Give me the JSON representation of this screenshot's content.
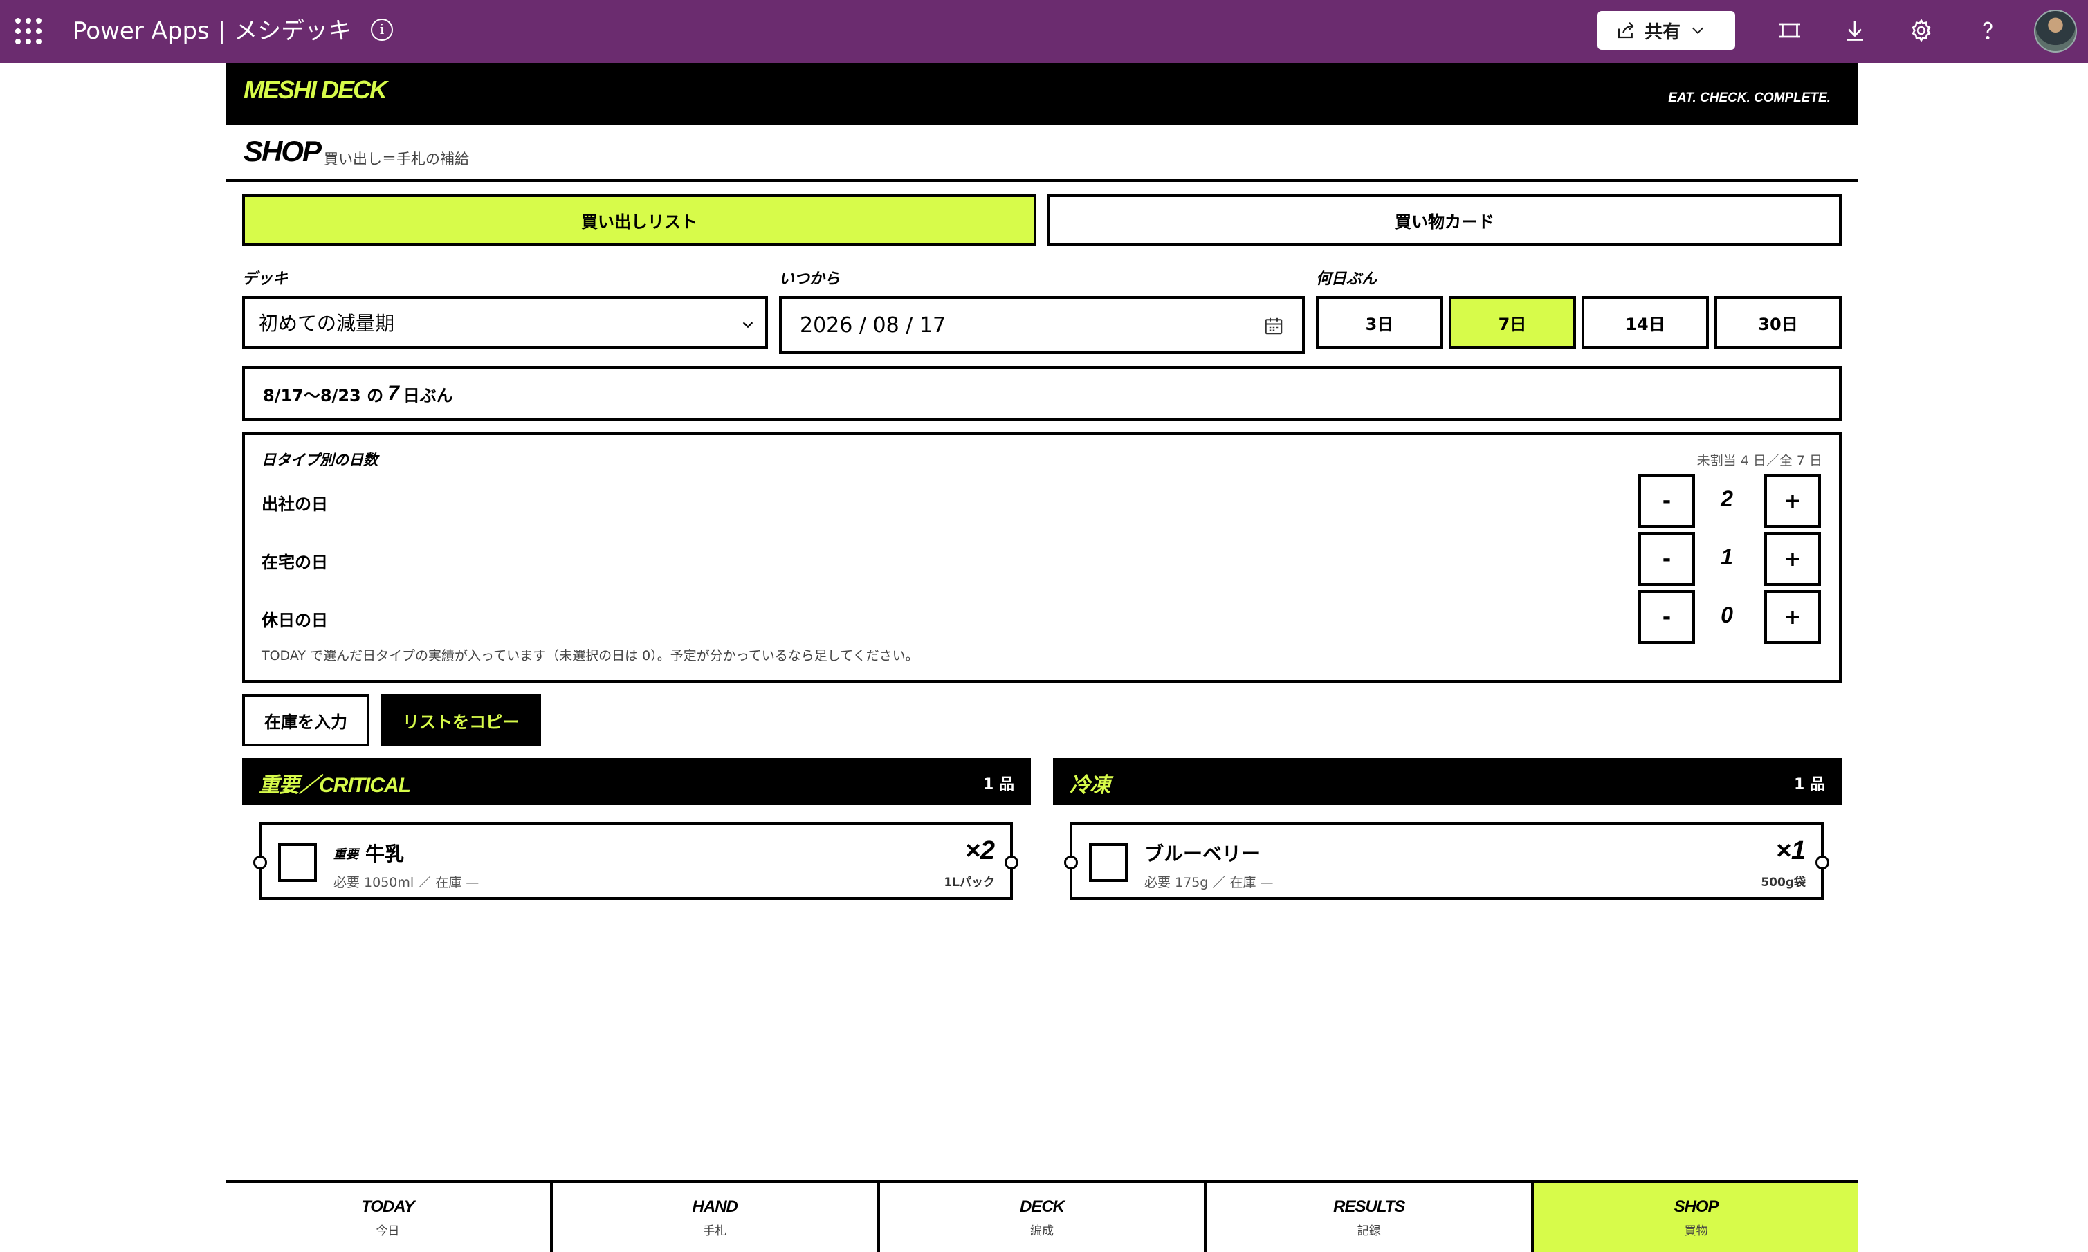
{
  "topbar": {
    "app_name": "Power Apps",
    "separator": "|",
    "app_title": "メシデッキ",
    "share_label": "共有"
  },
  "header": {
    "brand": "MESHI DECK",
    "tagline": "EAT. CHECK. COMPLETE."
  },
  "page": {
    "title": "SHOP",
    "subtitle": "買い出し＝手札の補給"
  },
  "tabs": [
    {
      "label": "買い出しリスト",
      "active": true
    },
    {
      "label": "買い物カード",
      "active": false
    }
  ],
  "filters": {
    "deck_label": "デッキ",
    "deck_value": "初めての減量期",
    "from_label": "いつから",
    "from_value": "2026 / 08 / 17",
    "days_label": "何日ぶん",
    "day_options": [
      {
        "label": "3日",
        "active": false
      },
      {
        "label": "7日",
        "active": true
      },
      {
        "label": "14日",
        "active": false
      },
      {
        "label": "30日",
        "active": false
      }
    ]
  },
  "range": {
    "prefix": "8/17〜8/23 の",
    "days": "7",
    "suffix": "日ぶん"
  },
  "day_types": {
    "title": "日タイプ別の日数",
    "unassigned": "未割当 4 日／全 7 日",
    "rows": [
      {
        "label": "出社の日",
        "value": "2"
      },
      {
        "label": "在宅の日",
        "value": "1"
      },
      {
        "label": "休日の日",
        "value": "0"
      }
    ],
    "minus": "-",
    "plus": "+",
    "note": "TODAY で選んだ日タイプの実績が入っています（未選択の日は 0）。予定が分かっているなら足してください。"
  },
  "actions": {
    "stock_label": "在庫を入力",
    "copy_label": "リストをコピー"
  },
  "categories": [
    {
      "name": "重要／CRITICAL",
      "count": "1 品",
      "items": [
        {
          "tag": "重要",
          "name": "牛乳",
          "meta": "必要 1050ml ／ 在庫 —",
          "qty": "×2",
          "unit": "1Lパック"
        }
      ]
    },
    {
      "name": "冷凍",
      "count": "1 品",
      "items": [
        {
          "tag": "",
          "name": "ブルーベリー",
          "meta": "必要 175g ／ 在庫 —",
          "qty": "×1",
          "unit": "500g袋"
        }
      ]
    }
  ],
  "bottom_nav": [
    {
      "en": "TODAY",
      "jp": "今日",
      "active": false
    },
    {
      "en": "HAND",
      "jp": "手札",
      "active": false
    },
    {
      "en": "DECK",
      "jp": "編成",
      "active": false
    },
    {
      "en": "RESULTS",
      "jp": "記録",
      "active": false
    },
    {
      "en": "SHOP",
      "jp": "買物",
      "active": true
    }
  ],
  "colors": {
    "topbar": "#6b2c6f",
    "accent": "#d7fb4a",
    "dark": "#000000"
  }
}
